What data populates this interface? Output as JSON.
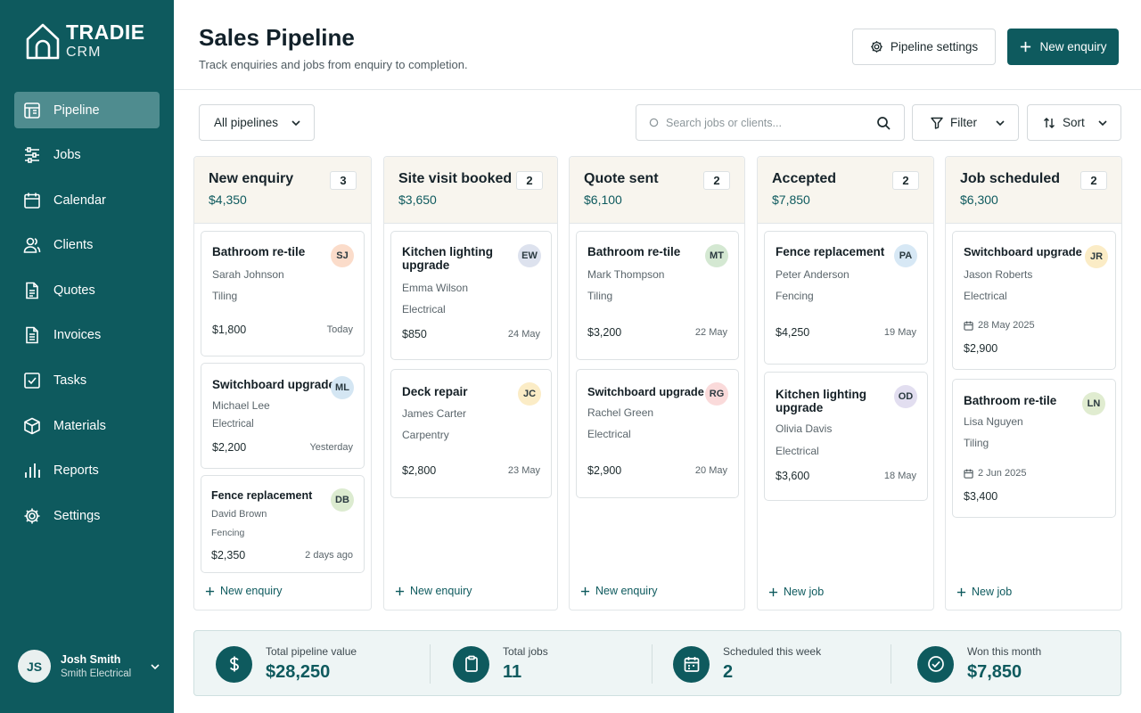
{
  "app": {
    "brand_line1": "TRADIE",
    "brand_line2": "CRM"
  },
  "sidebar": {
    "items": [
      {
        "label": "Pipeline",
        "icon": "pipeline-icon"
      },
      {
        "label": "Jobs",
        "icon": "sliders-icon"
      },
      {
        "label": "Calendar",
        "icon": "calendar-icon"
      },
      {
        "label": "Clients",
        "icon": "users-icon"
      },
      {
        "label": "Quotes",
        "icon": "document-icon"
      },
      {
        "label": "Invoices",
        "icon": "invoice-icon"
      },
      {
        "label": "Tasks",
        "icon": "checkbox-icon"
      },
      {
        "label": "Materials",
        "icon": "box-icon"
      },
      {
        "label": "Reports",
        "icon": "bar-chart-icon"
      },
      {
        "label": "Settings",
        "icon": "gear-icon"
      }
    ],
    "user": {
      "initials": "JS",
      "name": "Josh Smith",
      "company": "Smith Electrical"
    }
  },
  "header": {
    "title": "Sales Pipeline",
    "subtitle": "Track enquiries and jobs from enquiry to completion.",
    "settings_label": "Pipeline settings",
    "new_label": "New enquiry"
  },
  "toolbar": {
    "pipeline_select": "All pipelines",
    "search_placeholder": "Search jobs or clients...",
    "filter_label": "Filter",
    "sort_label": "Sort"
  },
  "columns": [
    {
      "title": "New enquiry",
      "count": "3",
      "total": "$4,350",
      "add_label": "New enquiry",
      "cards": [
        {
          "title": "Bathroom re-tile",
          "client": "Sarah Johnson",
          "trade": "Tiling",
          "price": "$1,800",
          "date": "Today",
          "initials": "SJ",
          "color": "#fbdcca"
        },
        {
          "title": "Switchboard upgrade",
          "client": "Michael Lee",
          "trade": "Electrical",
          "price": "$2,200",
          "date": "Yesterday",
          "initials": "ML",
          "color": "#d4e6f3"
        },
        {
          "title": "Fence replacement",
          "client": "David Brown",
          "trade": "Fencing",
          "price": "$2,350",
          "date": "2 days ago",
          "initials": "DB",
          "color": "#dcebd0"
        }
      ]
    },
    {
      "title": "Site visit booked",
      "count": "2",
      "total": "$3,650",
      "add_label": "New enquiry",
      "cards": [
        {
          "title": "Kitchen lighting upgrade",
          "client": "Emma Wilson",
          "trade": "Electrical",
          "price": "$850",
          "date": "24 May",
          "initials": "EW",
          "color": "#dde2ee"
        },
        {
          "title": "Deck repair",
          "client": "James Carter",
          "trade": "Carpentry",
          "price": "$2,800",
          "date": "23 May",
          "initials": "JC",
          "color": "#fbecc6"
        }
      ]
    },
    {
      "title": "Quote sent",
      "count": "2",
      "total": "$6,100",
      "add_label": "New enquiry",
      "cards": [
        {
          "title": "Bathroom re-tile",
          "client": "Mark Thompson",
          "trade": "Tiling",
          "price": "$3,200",
          "date": "22 May",
          "initials": "MT",
          "color": "#d4e8d2"
        },
        {
          "title": "Switchboard upgrade",
          "client": "Rachel Green",
          "trade": "Electrical",
          "price": "$2,900",
          "date": "20 May",
          "initials": "RG",
          "color": "#fadada"
        }
      ]
    },
    {
      "title": "Accepted",
      "count": "2",
      "total": "$7,850",
      "add_label": "New job",
      "cards": [
        {
          "title": "Fence replacement",
          "client": "Peter Anderson",
          "trade": "Fencing",
          "price": "$4,250",
          "date": "19 May",
          "initials": "PA",
          "color": "#d7e8f5"
        },
        {
          "title": "Kitchen lighting upgrade",
          "client": "Olivia Davis",
          "trade": "Electrical",
          "price": "$3,600",
          "date": "18 May",
          "initials": "OD",
          "color": "#e2def0"
        }
      ]
    },
    {
      "title": "Job scheduled",
      "count": "2",
      "total": "$6,300",
      "add_label": "New job",
      "cards": [
        {
          "title": "Switchboard upgrade",
          "client": "Jason Roberts",
          "trade": "Electrical",
          "scheduled": "28 May 2025",
          "price": "$2,900",
          "initials": "JR",
          "color": "#fbecc6"
        },
        {
          "title": "Bathroom re-tile",
          "client": "Lisa Nguyen",
          "trade": "Tiling",
          "scheduled": "2 Jun 2025",
          "price": "$3,400",
          "initials": "LN",
          "color": "#e0ecd0"
        }
      ]
    }
  ],
  "stats": [
    {
      "label": "Total pipeline value",
      "value": "$28,250",
      "icon": "dollar-icon"
    },
    {
      "label": "Total jobs",
      "value": "11",
      "icon": "clipboard-icon"
    },
    {
      "label": "Scheduled this week",
      "value": "2",
      "icon": "calendar-icon"
    },
    {
      "label": "Won this month",
      "value": "$7,850",
      "icon": "check-circle-icon"
    }
  ]
}
